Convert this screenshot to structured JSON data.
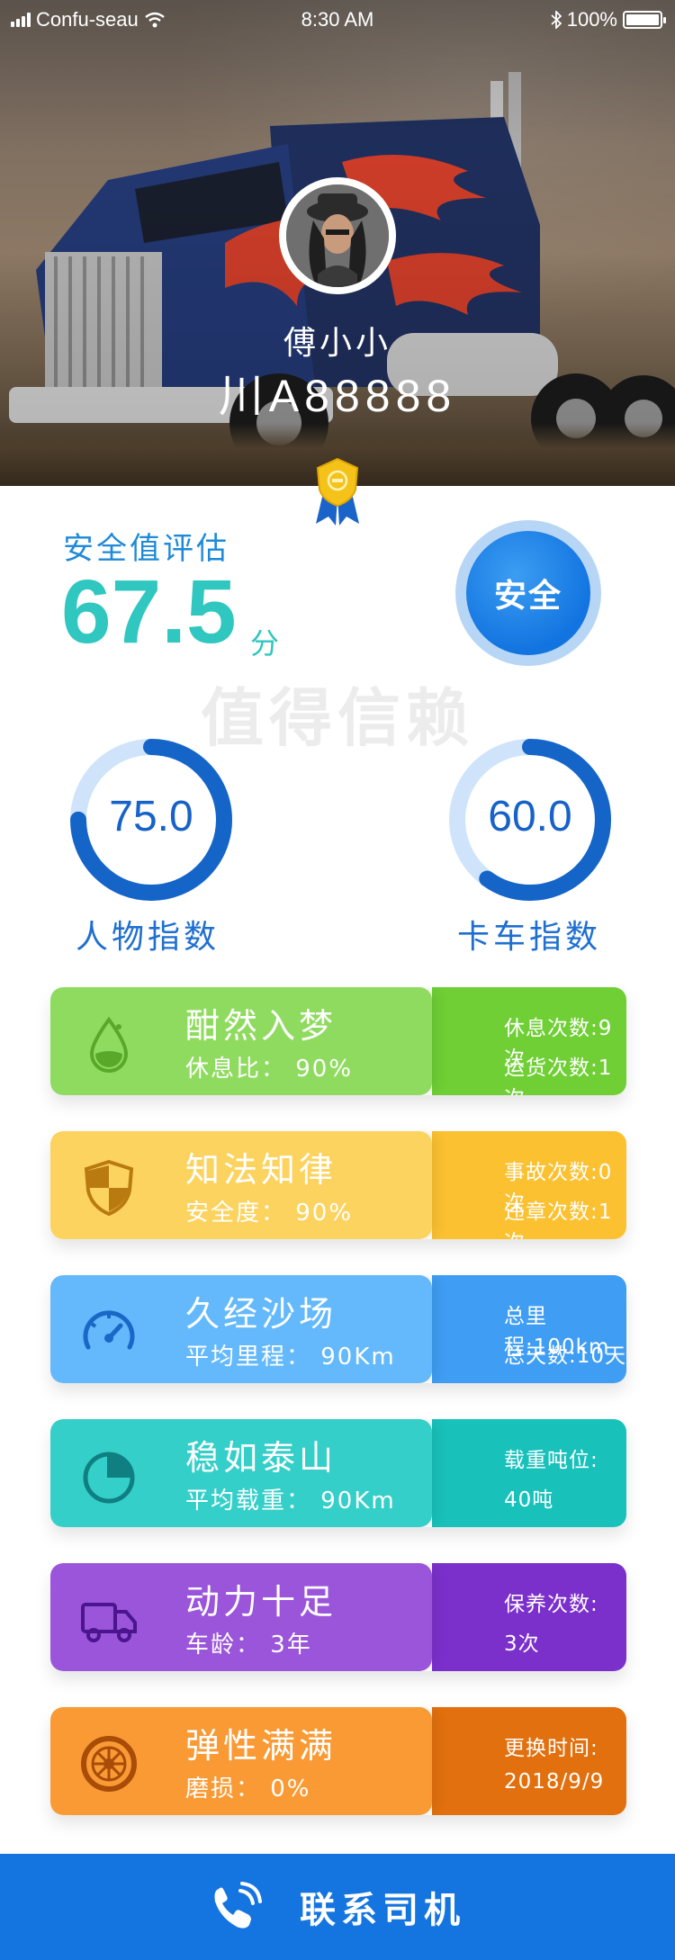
{
  "status_bar": {
    "carrier": "Confu-seau",
    "time": "8:30 AM",
    "battery": "100%",
    "icons": [
      "signal-icon",
      "wifi-icon",
      "bluetooth-icon",
      "battery-icon"
    ]
  },
  "hero": {
    "driver_name": "傅小小",
    "license_plate": "川A88888"
  },
  "safety": {
    "title": "安全值评估",
    "score": "67.5",
    "unit": "分",
    "badge": "安全",
    "watermark": "值得信赖"
  },
  "indices": [
    {
      "value": "75.0",
      "label": "人物指数",
      "percent": 75
    },
    {
      "value": "60.0",
      "label": "卡车指数",
      "percent": 60
    }
  ],
  "cards": [
    {
      "icon": "water-drop-icon",
      "title": "酣然入梦",
      "subtitle": "休息比：  90%",
      "side_line1": "休息次数:9次",
      "side_line2": "运货次数:1次",
      "color_main": "#8fdb5f",
      "color_side": "#6fcf35",
      "icon_color": "#5aa82a"
    },
    {
      "icon": "shield-icon",
      "title": "知法知律",
      "subtitle": "安全度：  90%",
      "side_line1": "事故次数:0次",
      "side_line2": "违章次数:1次",
      "color_main": "#fdd35f",
      "color_side": "#fbc131",
      "icon_color": "#b97a10"
    },
    {
      "icon": "speedometer-icon",
      "title": "久经沙场",
      "subtitle": "平均里程：  90Km",
      "side_line1": "总里程:100km",
      "side_line2": "总天数:10天",
      "color_main": "#63b9fb",
      "color_side": "#3f9df3",
      "icon_color": "#1967c6"
    },
    {
      "icon": "pie-chart-icon",
      "title": "稳如泰山",
      "subtitle": "平均载重：  90Km",
      "side_line1": "载重吨位:",
      "side_line2": "40吨",
      "color_main": "#35cfc9",
      "color_side": "#19c1bb",
      "icon_color": "#0f7f82"
    },
    {
      "icon": "delivery-truck-icon",
      "title": "动力十足",
      "subtitle": "车龄：  3年",
      "side_line1": "保养次数:",
      "side_line2": "3次",
      "color_main": "#9a55da",
      "color_side": "#7b30cc",
      "icon_color": "#4a158f"
    },
    {
      "icon": "tire-icon",
      "title": "弹性满满",
      "subtitle": "磨损：  0%",
      "side_line1": "更换时间:",
      "side_line2": "2018/9/9",
      "color_main": "#f99a34",
      "color_side": "#e2700e",
      "icon_color": "#a84c08"
    }
  ],
  "contact": {
    "icon": "phone-icon",
    "label": "联系司机"
  }
}
